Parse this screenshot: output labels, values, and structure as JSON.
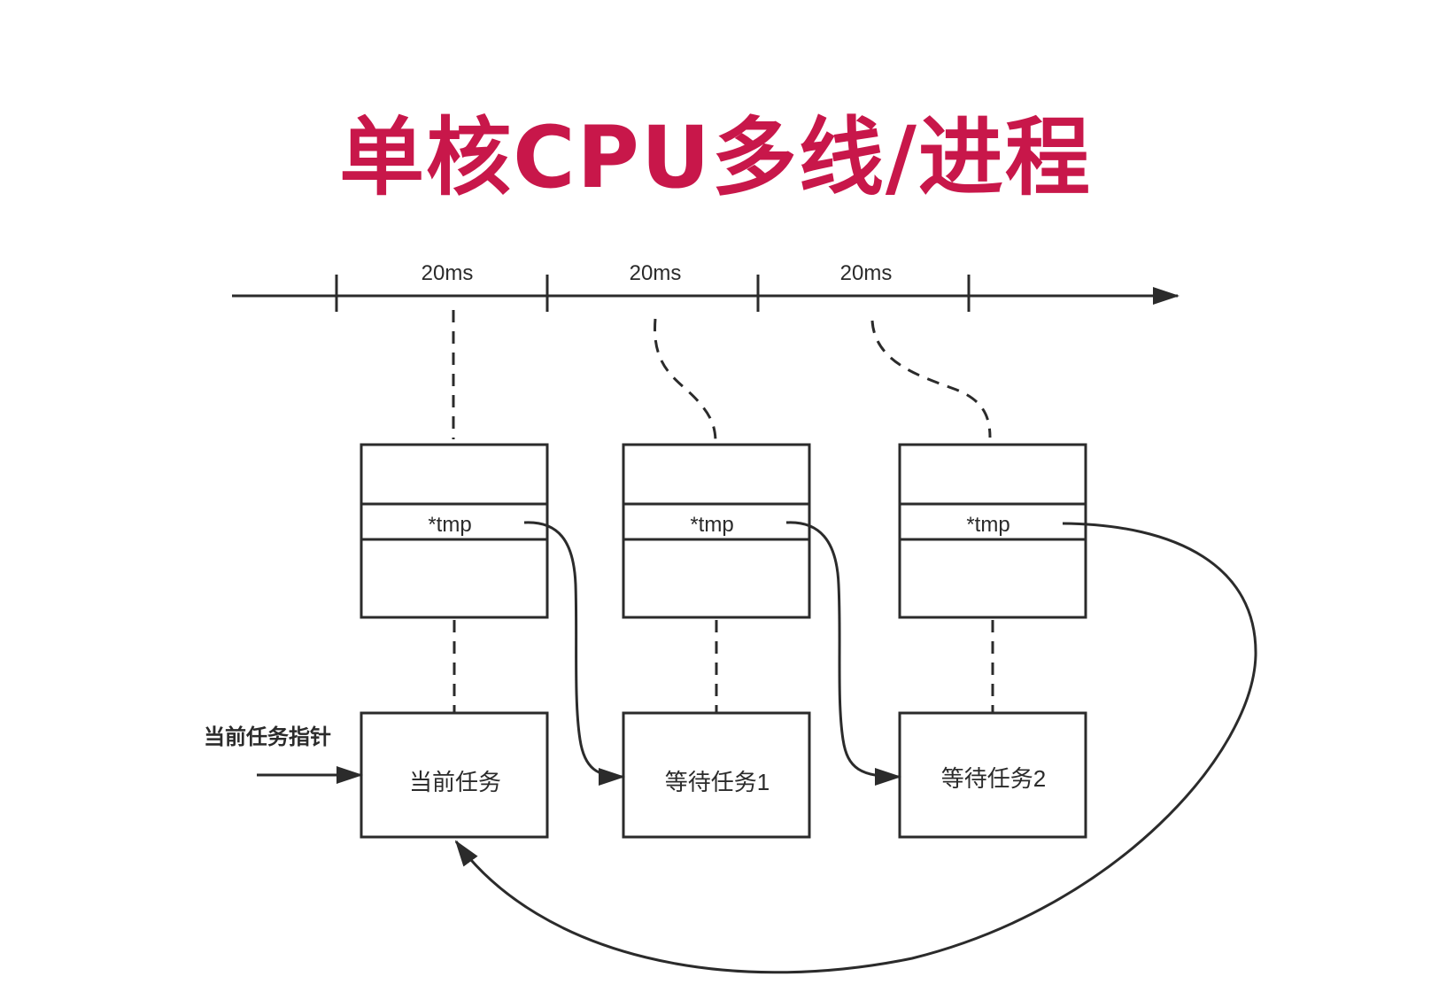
{
  "title": "单核CPU多线/进程",
  "colors": {
    "title": "#c8174a",
    "stroke": "#2b2b2b"
  },
  "timeline": {
    "slices": [
      "20ms",
      "20ms",
      "20ms"
    ]
  },
  "tasks": [
    {
      "field": "*tmp",
      "label": "当前任务"
    },
    {
      "field": "*tmp",
      "label": "等待任务1"
    },
    {
      "field": "*tmp",
      "label": "等待任务2"
    }
  ],
  "pointer_label": "当前任务指针"
}
